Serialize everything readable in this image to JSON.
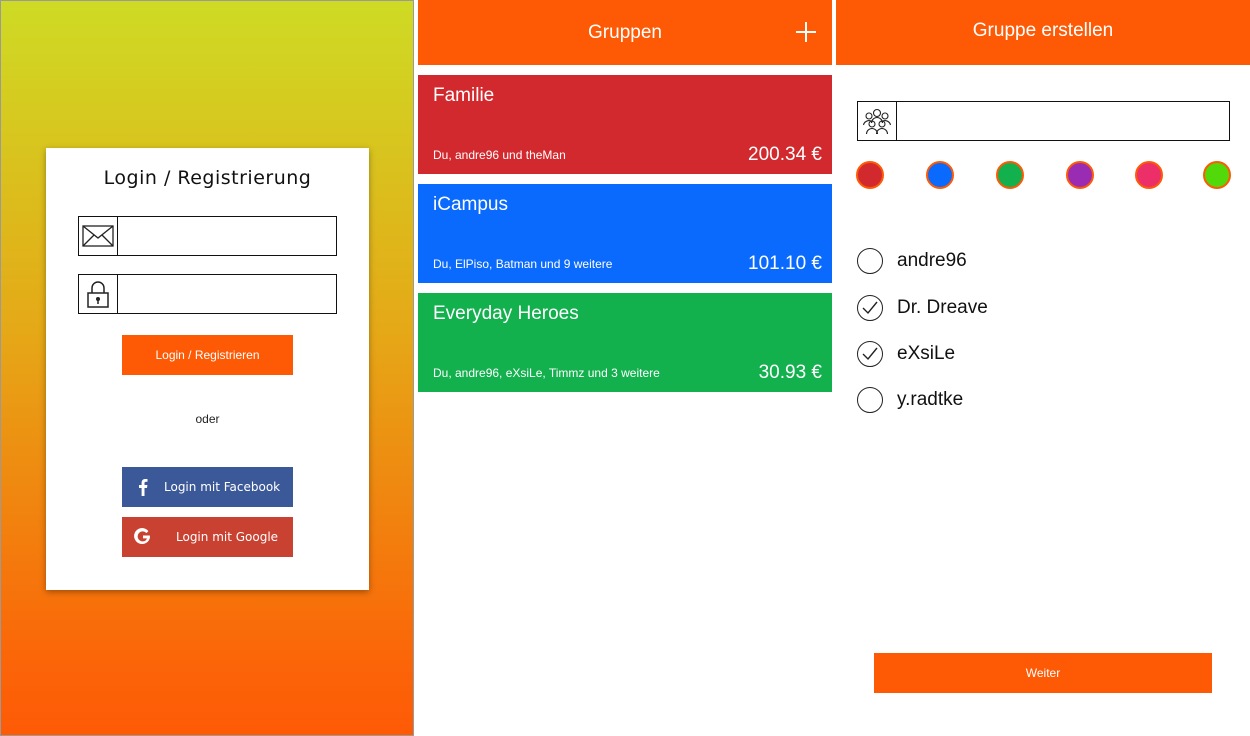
{
  "login": {
    "title": "Login / Registrierung",
    "email_icon": "envelope-icon",
    "password_icon": "lock-icon",
    "email_value": "",
    "password_value": "",
    "login_button": "Login / Registrieren",
    "or_text": "oder",
    "facebook_button": "Login mit Facebook",
    "google_button": "Login mit Google",
    "colors": {
      "accent": "#fe5a06",
      "facebook": "#3b5998",
      "google": "#c94130"
    }
  },
  "groups": {
    "title": "Gruppen",
    "add_icon": "plus-icon",
    "items": [
      {
        "name": "Familie",
        "members": "Du, andre96 und theMan",
        "amount": "200.34 €",
        "color": "#d2292e"
      },
      {
        "name": "iCampus",
        "members": "Du, ElPiso, Batman und 9 weitere",
        "amount": "101.10 €",
        "color": "#0a6afe"
      },
      {
        "name": "Everyday Heroes",
        "members": "Du, andre96, eXsiLe, Timmz und 3 weitere",
        "amount": "30.93 €",
        "color": "#13b14e"
      }
    ]
  },
  "create": {
    "title": "Gruppe erstellen",
    "group_icon": "group-icon",
    "name_value": "",
    "swatches": [
      "#d2292e",
      "#0a6afe",
      "#13b14e",
      "#9a2cb4",
      "#ec2f69",
      "#52d90a"
    ],
    "members": [
      {
        "name": "andre96",
        "checked": false
      },
      {
        "name": "Dr. Dreave",
        "checked": true
      },
      {
        "name": "eXsiLe",
        "checked": true
      },
      {
        "name": "y.radtke",
        "checked": false
      }
    ],
    "next_button": "Weiter"
  }
}
